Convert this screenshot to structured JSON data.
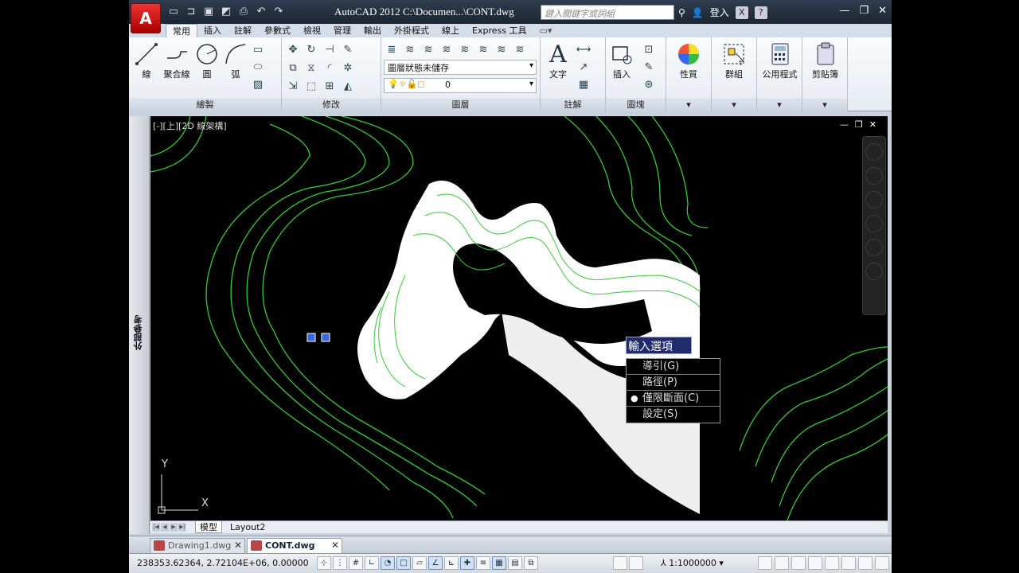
{
  "titlebar": {
    "app_letter": "A",
    "title": "AutoCAD 2012    C:\\Documen...\\CONT.dwg",
    "search_placeholder": "鍵入關鍵字或詞組",
    "login": "登入",
    "qat_icons": [
      "new-icon",
      "open-icon",
      "save-icon",
      "save-as-icon",
      "print-icon",
      "undo-icon",
      "redo-icon"
    ]
  },
  "ribbon_tabs": [
    "常用",
    "插入",
    "註解",
    "參數式",
    "檢視",
    "管理",
    "輸出",
    "外掛程式",
    "線上",
    "Express 工具"
  ],
  "ribbon": {
    "draw": {
      "title": "繪製",
      "line": "線",
      "polyline": "聚合線",
      "circle": "圓",
      "arc": "弧"
    },
    "modify": {
      "title": "修改"
    },
    "layers": {
      "title": "圖層",
      "state": "圖層狀態未儲存",
      "current": "0"
    },
    "annotation": {
      "title": "註解",
      "text": "文字"
    },
    "block": {
      "title": "圖塊",
      "insert": "插入"
    },
    "properties": "性質",
    "groups": "群組",
    "utilities": "公用程式",
    "clipboard": "剪貼簿"
  },
  "palette": {
    "label": "外部參考"
  },
  "viewport": {
    "label": "[-][上][2D 線架構]",
    "ucs_x": "X",
    "ucs_y": "Y"
  },
  "context_menu": {
    "header": "輸入選項",
    "items": [
      {
        "label": "導引(G)",
        "selected": false
      },
      {
        "label": "路徑(P)",
        "selected": false
      },
      {
        "label": "僅限斷面(C)",
        "selected": true
      },
      {
        "label": "設定(S)",
        "selected": false
      }
    ]
  },
  "layout_tabs": {
    "model": "模型",
    "layout2": "Layout2"
  },
  "documents": [
    {
      "name": "Drawing1.dwg",
      "active": false
    },
    {
      "name": "CONT.dwg",
      "active": true
    }
  ],
  "statusbar": {
    "coords": "238353.62364, 2.72104E+06, 0.00000",
    "scale": "1:1000000"
  },
  "colors": {
    "contour": "#33cc33",
    "loft_fill": "#ffffff",
    "menu_header": "#1f2b6b"
  }
}
